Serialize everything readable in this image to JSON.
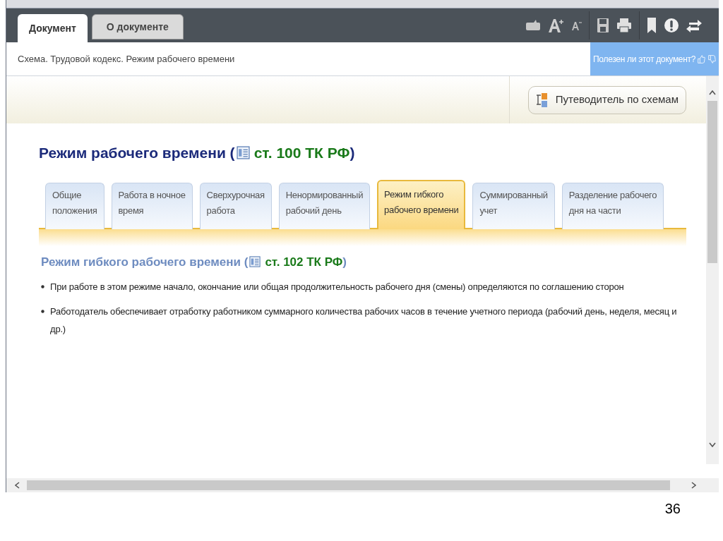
{
  "doc_tabs": [
    {
      "label": "Документ",
      "selected": true
    },
    {
      "label": "О документе",
      "selected": false
    }
  ],
  "breadcrumb": "Схема. Трудовой кодекс. Режим рабочего времени",
  "feedback": {
    "question": "Полезен ли этот документ?"
  },
  "guide_button": "Путеводитель по схемам",
  "heading": {
    "prefix": "Режим рабочего времени (",
    "link": "ст. 100 ТК РФ",
    "suffix": ")"
  },
  "tabs": [
    {
      "label": "Общие\nположения",
      "selected": false
    },
    {
      "label": "Работа в ночное\nвремя",
      "selected": false
    },
    {
      "label": "Сверхурочная\nработа",
      "selected": false
    },
    {
      "label": "Ненормированный\nрабочий день",
      "selected": false
    },
    {
      "label": "Режим гибкого\nрабочего времени",
      "selected": true
    },
    {
      "label": "Суммированный\nучет",
      "selected": false
    },
    {
      "label": "Разделение рабочего\nдня на части",
      "selected": false
    }
  ],
  "subheading": {
    "prefix": "Режим гибкого рабочего времени (",
    "link": "ст. 102 ТК РФ",
    "suffix": ")"
  },
  "bullets": [
    "При работе в этом режиме начало, окончание или общая продолжительность рабочего дня (смены) определяются по соглашению сторон",
    "Работодатель обеспечивает отработку работником суммарного количества рабочих часов в течение учетного периода (рабочий день, неделя, месяц и др.)"
  ],
  "slide_number": "36"
}
